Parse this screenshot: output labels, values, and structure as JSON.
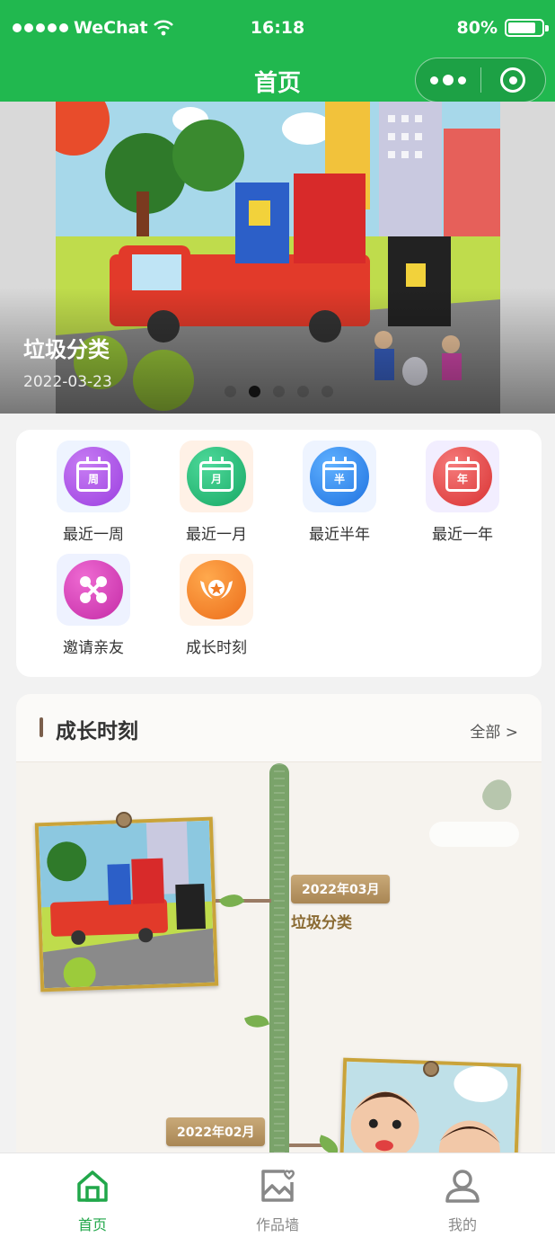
{
  "status_bar": {
    "carrier": "WeChat",
    "time": "16:18",
    "battery": "80%"
  },
  "nav": {
    "title": "首页"
  },
  "banner": {
    "title": "垃圾分类",
    "date": "2022-03-23",
    "slide_count": 5,
    "active_slide": 2
  },
  "menu": {
    "items": [
      {
        "label": "最近一周",
        "glyph": "周",
        "icon": "calendar-week-icon",
        "color": "#a64de6",
        "tile": "#eef4ff"
      },
      {
        "label": "最近一月",
        "glyph": "月",
        "icon": "calendar-month-icon",
        "color": "#22b876",
        "tile": "#fff1e6"
      },
      {
        "label": "最近半年",
        "glyph": "半",
        "icon": "calendar-halfyear-icon",
        "color": "#2f86f0",
        "tile": "#eef4ff"
      },
      {
        "label": "最近一年",
        "glyph": "年",
        "icon": "calendar-year-icon",
        "color": "#e64545",
        "tile": "#f2eeff"
      },
      {
        "label": "邀请亲友",
        "glyph": "",
        "icon": "share-icon",
        "color": "#d43fb8",
        "tile": "#eef2ff"
      },
      {
        "label": "成长时刻",
        "glyph": "",
        "icon": "medal-icon",
        "color": "#f07a22",
        "tile": "#fff3e8"
      }
    ]
  },
  "growth": {
    "title": "成长时刻",
    "all_label": "全部 >",
    "entries": [
      {
        "date": "2022年03月",
        "title": "垃圾分类"
      },
      {
        "date": "2022年02月",
        "title": ""
      }
    ]
  },
  "tabbar": {
    "items": [
      {
        "label": "首页",
        "icon": "home-icon",
        "active": true
      },
      {
        "label": "作品墙",
        "icon": "gallery-icon",
        "active": false
      },
      {
        "label": "我的",
        "icon": "user-icon",
        "active": false
      }
    ]
  },
  "colors": {
    "primary": "#21b84f",
    "tab_active": "#21a74a",
    "brown": "#8a6a32"
  }
}
